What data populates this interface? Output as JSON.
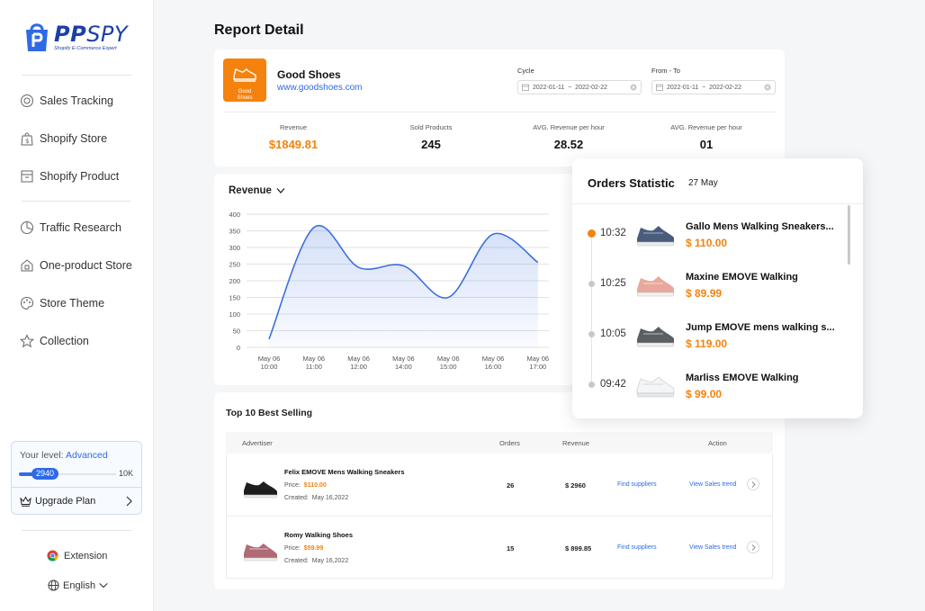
{
  "brand": {
    "name_a": "PP",
    "name_b": "SPY",
    "tagline": "Shopify E-Commerce Expert"
  },
  "sidebar": {
    "items": [
      {
        "label": "Sales Tracking",
        "icon": "target-icon"
      },
      {
        "label": "Shopify Store",
        "icon": "shopify-bag-icon"
      },
      {
        "label": "Shopify Product",
        "icon": "box-icon"
      },
      {
        "label": "Traffic Research",
        "icon": "pie-chart-icon"
      },
      {
        "label": "One-product Store",
        "icon": "store-icon"
      },
      {
        "label": "Store Theme",
        "icon": "palette-icon"
      },
      {
        "label": "Collection",
        "icon": "star-icon"
      }
    ],
    "level": {
      "prefix": "Your level:",
      "value": "Advanced",
      "current": "2940",
      "max": "10K",
      "progress_fraction": 0.294
    },
    "upgrade_label": "Upgrade Plan",
    "extension_label": "Extension",
    "language_label": "English"
  },
  "page": {
    "title": "Report Detail"
  },
  "store": {
    "logo_text": "Good Shoes",
    "name": "Good Shoes",
    "url": "www.goodshoes.com",
    "cycle": {
      "label": "Cycle",
      "start": "2022-01-11",
      "sep": "~",
      "end": "2022-02-22"
    },
    "from_to": {
      "label": "From - To",
      "start": "2022-01-11",
      "sep": "~",
      "end": "2022-02-22"
    },
    "metrics": [
      {
        "label": "Revenue",
        "value": "$1849.81"
      },
      {
        "label": "Sold Products",
        "value": "245"
      },
      {
        "label": "AVG. Revenue per hour",
        "value": "28.52"
      },
      {
        "label": "AVG. Revenue per hour",
        "value": "01"
      }
    ]
  },
  "chart": {
    "selector_label": "Revenue"
  },
  "chart_data": {
    "type": "area",
    "title": "Revenue",
    "categories": [
      "May 06\n10:00",
      "May 06\n11:00",
      "May 06\n12:00",
      "May 06\n14:00",
      "May 06\n15:00",
      "May 06\n16:00",
      "May 06\n17:00"
    ],
    "category_lines": [
      [
        "May 06",
        "10:00"
      ],
      [
        "May 06",
        "11:00"
      ],
      [
        "May 06",
        "12:00"
      ],
      [
        "May 06",
        "14:00"
      ],
      [
        "May 06",
        "15:00"
      ],
      [
        "May 06",
        "16:00"
      ],
      [
        "May 06",
        "17:00"
      ]
    ],
    "values": [
      25,
      360,
      240,
      245,
      150,
      340,
      255
    ],
    "yticks": [
      0,
      50,
      100,
      150,
      200,
      250,
      300,
      350,
      400
    ],
    "ylim": [
      0,
      400
    ],
    "color": "#3b6fe0",
    "grid": true
  },
  "table": {
    "title": "Top 10 Best Selling",
    "headers": {
      "advertiser": "Advertiser",
      "orders": "Orders",
      "revenue": "Revenue",
      "action": "Action"
    },
    "price_prefix": "Price:",
    "created_prefix": "Created:",
    "rows": [
      {
        "name": "Felix EMOVE Mens Walking Sneakers",
        "price": "$110.00",
        "created": "May 16,2022",
        "orders": "26",
        "revenue": "$ 2960",
        "find": "Find suppliers",
        "trend": "View Sales trend"
      },
      {
        "name": "Romy Walking Shoes",
        "price": "$59.99",
        "created": "May 16,2022",
        "orders": "15",
        "revenue": "$ 899.85",
        "find": "Find suppliers",
        "trend": "View Sales trend"
      }
    ]
  },
  "orders_popup": {
    "title": "Orders Statistic",
    "date": "27 May",
    "items": [
      {
        "time": "10:32",
        "name": "Gallo Mens Walking Sneakers...",
        "price": "$ 110.00"
      },
      {
        "time": "10:25",
        "name": "Maxine EMOVE Walking",
        "price": "$ 89.99"
      },
      {
        "time": "10:05",
        "name": "Jump EMOVE mens walking s...",
        "price": "$ 119.00"
      },
      {
        "time": "09:42",
        "name": "Marliss EMOVE Walking",
        "price": "$ 99.00"
      }
    ]
  },
  "colors": {
    "accent": "#2f6ae5",
    "orange": "#f5820d",
    "brand": "#1c3fa8"
  }
}
